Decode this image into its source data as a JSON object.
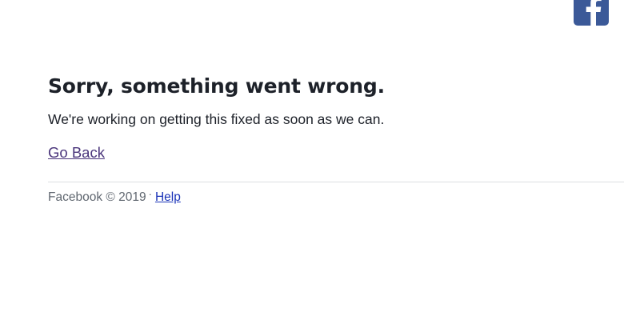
{
  "header": {
    "logo_icon": "facebook-f-icon",
    "brand_color": "#3b5998"
  },
  "error": {
    "title": "Sorry, something went wrong.",
    "message": "We're working on getting this fixed as soon as we can.",
    "back_link": "Go Back"
  },
  "footer": {
    "copyright": "Facebook © 2019",
    "separator": "·",
    "help_link": "Help"
  }
}
